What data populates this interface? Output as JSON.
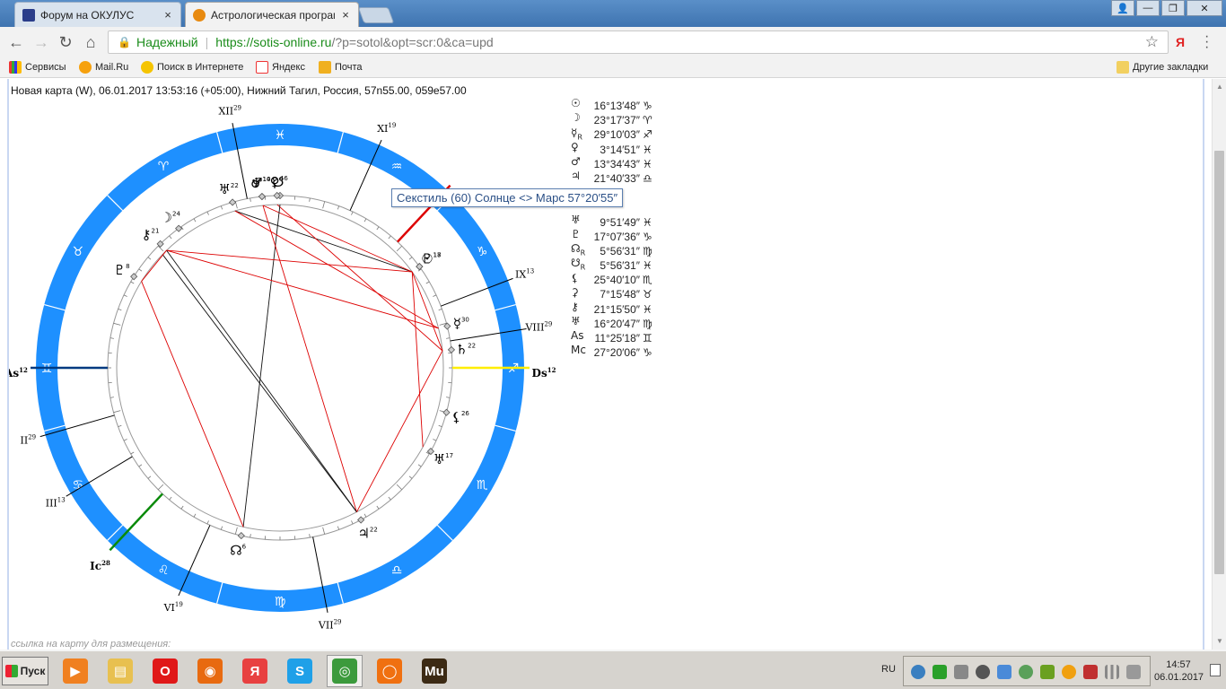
{
  "tabs": [
    {
      "label": "Форум на ОКУЛУС",
      "close": "×"
    },
    {
      "label": "Астрологическая програм",
      "close": "×"
    }
  ],
  "address": {
    "secure_label": "Надежный",
    "url_host": "https://sotis-online.ru",
    "url_path": "/?p=sotol&opt=scr:0&ca=upd"
  },
  "bookmarks": [
    {
      "label": "Сервисы"
    },
    {
      "label": "Mail.Ru"
    },
    {
      "label": "Поиск в Интернете"
    },
    {
      "label": "Яндекс"
    },
    {
      "label": "Почта"
    }
  ],
  "other_bookmarks": "Другие закладки",
  "extension_label": "Я",
  "page": {
    "header": "Новая карта (W), 06.01.2017 13:53:16 (+05:00), Нижний Тагил, Россия, 57n55.00, 059e57.00",
    "tooltip": "Секстиль (60) Солнце <> Марс 57°20′55″",
    "link_label": "ссылка на карту для размещения:"
  },
  "planet_list": [
    {
      "glyph": "☉",
      "retro": "",
      "pos": "16°13′48″",
      "sign": "♑"
    },
    {
      "glyph": "☽",
      "retro": "",
      "pos": "23°17′37″",
      "sign": "♈"
    },
    {
      "glyph": "☿",
      "retro": "R",
      "pos": "29°10′03″",
      "sign": "♐"
    },
    {
      "glyph": "♀",
      "retro": "",
      "pos": "3°14′51″",
      "sign": "♓"
    },
    {
      "glyph": "♂",
      "retro": "",
      "pos": "13°34′43″",
      "sign": "♓"
    },
    {
      "glyph": "♃",
      "retro": "",
      "pos": "21°40′33″",
      "sign": "♎"
    },
    {
      "glyph": "",
      "retro": "",
      "pos": "",
      "sign": ""
    },
    {
      "glyph": "",
      "retro": "",
      "pos": "",
      "sign": ""
    },
    {
      "glyph": "♅",
      "retro": "",
      "pos": "9°51′49″",
      "sign": "♓"
    },
    {
      "glyph": "♇",
      "retro": "",
      "pos": "17°07′36″",
      "sign": "♑"
    },
    {
      "glyph": "☊",
      "retro": "R",
      "pos": "5°56′31″",
      "sign": "♍"
    },
    {
      "glyph": "☋",
      "retro": "R",
      "pos": "5°56′31″",
      "sign": "♓"
    },
    {
      "glyph": "⚸",
      "retro": "",
      "pos": "25°40′10″",
      "sign": "♏"
    },
    {
      "glyph": "⚳",
      "retro": "",
      "pos": "7°15′48″",
      "sign": "♉"
    },
    {
      "glyph": "⚷",
      "retro": "",
      "pos": "21°15′50″",
      "sign": "♓"
    },
    {
      "glyph": "♅",
      "retro": "",
      "pos": "16°20′47″",
      "sign": "♍"
    },
    {
      "glyph": "As",
      "retro": "",
      "pos": "11°25′18″",
      "sign": "♊"
    },
    {
      "glyph": "Mc",
      "retro": "",
      "pos": "27°20′06″",
      "sign": "♑"
    }
  ],
  "wheel": {
    "zodiac_ring_color": "#1e90ff",
    "zodiac_signs": [
      {
        "glyph": "♓",
        "angle": 90
      },
      {
        "glyph": "♒",
        "angle": 60
      },
      {
        "glyph": "♑",
        "angle": 30
      },
      {
        "glyph": "♐",
        "angle": 0
      },
      {
        "glyph": "♏",
        "angle": -30
      },
      {
        "glyph": "♎",
        "angle": -60
      },
      {
        "glyph": "♍",
        "angle": -90
      },
      {
        "glyph": "♌",
        "angle": -120
      },
      {
        "glyph": "♋",
        "angle": -150
      },
      {
        "glyph": "♊",
        "angle": 180
      },
      {
        "glyph": "♉",
        "angle": 150
      },
      {
        "glyph": "♈",
        "angle": 120
      }
    ],
    "houses": [
      {
        "label": "XII",
        "deg": "29",
        "angle": 101
      },
      {
        "label": "XI",
        "deg": "19",
        "angle": 66
      },
      {
        "label": "IX",
        "deg": "13",
        "angle": 21
      },
      {
        "label": "VIII",
        "deg": "29",
        "angle": 9
      },
      {
        "label": "II",
        "deg": "29",
        "angle": 196
      },
      {
        "label": "III",
        "deg": "13",
        "angle": 211
      },
      {
        "label": "VI",
        "deg": "19",
        "angle": 246
      },
      {
        "label": "VII",
        "deg": "29",
        "angle": 281
      }
    ],
    "axes": [
      {
        "label": "As",
        "deg": "12",
        "angle": 180,
        "color": "#003a80"
      },
      {
        "label": "Ds",
        "deg": "12",
        "angle": 0,
        "color": "#ffee00"
      },
      {
        "label": "Ic",
        "deg": "28",
        "angle": 227,
        "color": "#0a8a0a"
      },
      {
        "label": "Mc",
        "deg": "28",
        "angle": 47,
        "color": "#dd0000"
      }
    ],
    "planets": [
      {
        "glyph": "♂",
        "deg": "14",
        "angle": 96
      },
      {
        "glyph": "☋",
        "deg": "6",
        "angle": 90
      },
      {
        "glyph": "♅",
        "deg": "22",
        "angle": 106
      },
      {
        "glyph": "♆",
        "deg": "10",
        "angle": 96
      },
      {
        "glyph": "♀",
        "deg": "4",
        "angle": 91
      },
      {
        "glyph": "☽",
        "deg": "24",
        "angle": 126
      },
      {
        "glyph": "⚷",
        "deg": "21",
        "angle": 134
      },
      {
        "glyph": "♇",
        "deg": "8",
        "angle": 148
      },
      {
        "glyph": "♇",
        "deg": "18",
        "angle": 36
      },
      {
        "glyph": "☉",
        "deg": "17",
        "angle": 36
      },
      {
        "glyph": "☿",
        "deg": "30",
        "angle": 14
      },
      {
        "glyph": "♄",
        "deg": "22",
        "angle": 6
      },
      {
        "glyph": "⚸",
        "deg": "26",
        "angle": -15
      },
      {
        "glyph": "♅",
        "deg": "17",
        "angle": -29
      },
      {
        "glyph": "♃",
        "deg": "22",
        "angle": -62
      },
      {
        "glyph": "☊",
        "deg": "6",
        "angle": -103
      }
    ],
    "aspects": [
      {
        "from": 106,
        "to": 36,
        "color": "#111111"
      },
      {
        "from": 96,
        "to": 36,
        "color": "#dd0000"
      },
      {
        "from": 91,
        "to": 6,
        "color": "#dd0000"
      },
      {
        "from": 90,
        "to": -103,
        "color": "#111111"
      },
      {
        "from": 96,
        "to": -62,
        "color": "#dd0000"
      },
      {
        "from": 134,
        "to": 36,
        "color": "#dd0000"
      },
      {
        "from": 134,
        "to": 14,
        "color": "#dd0000"
      },
      {
        "from": 134,
        "to": -62,
        "color": "#111111"
      },
      {
        "from": 136,
        "to": -62,
        "color": "#111111"
      },
      {
        "from": 148,
        "to": -103,
        "color": "#dd0000"
      },
      {
        "from": 36,
        "to": 6,
        "color": "#dd0000"
      },
      {
        "from": 36,
        "to": -29,
        "color": "#dd0000"
      },
      {
        "from": 6,
        "to": -62,
        "color": "#dd0000"
      },
      {
        "from": 106,
        "to": 14,
        "color": "#dd0000"
      },
      {
        "from": 148,
        "to": 134,
        "color": "#dd0000"
      }
    ]
  },
  "taskbar": {
    "start_label": "Пуск",
    "apps": [
      {
        "name": "media-player-icon",
        "color": "#f08020",
        "glyph": "▶"
      },
      {
        "name": "file-manager-icon",
        "color": "#e8c050",
        "glyph": "▤"
      },
      {
        "name": "opera-icon",
        "color": "#e01818",
        "glyph": "O"
      },
      {
        "name": "firefox-icon",
        "color": "#e86a10",
        "glyph": "◉"
      },
      {
        "name": "yandex-browser-icon",
        "color": "#e84040",
        "glyph": "Я"
      },
      {
        "name": "skype-icon",
        "color": "#1fa0e8",
        "glyph": "S"
      },
      {
        "name": "chrome-icon",
        "color": "#3c9a3c",
        "glyph": "◎"
      },
      {
        "name": "origin-icon",
        "color": "#f07010",
        "glyph": "◯"
      },
      {
        "name": "muse-icon",
        "color": "#3c2a14",
        "glyph": "Mu"
      }
    ],
    "lang": "RU",
    "time": "14:57",
    "date": "06.01.2017"
  }
}
